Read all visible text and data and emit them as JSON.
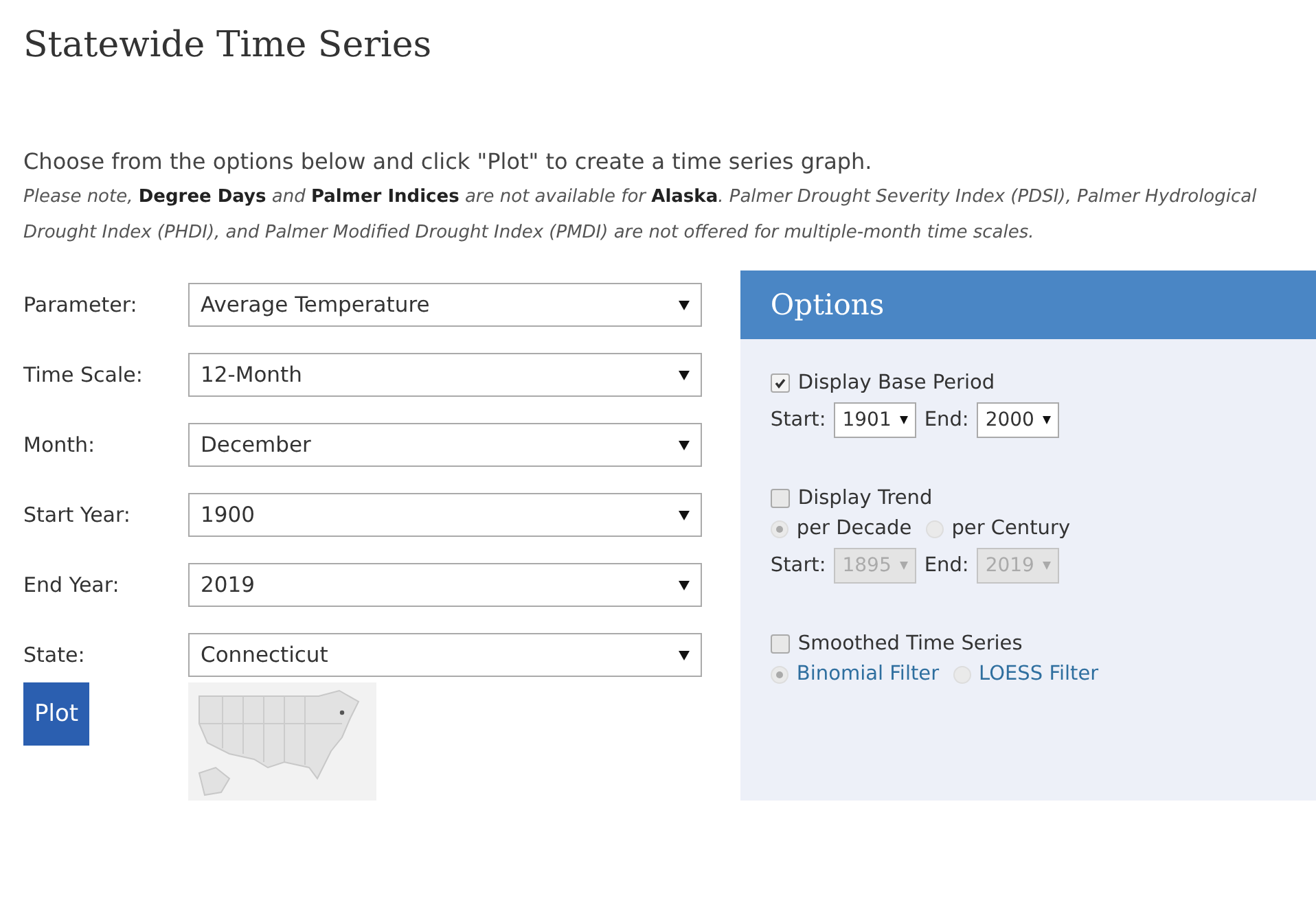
{
  "title": "Statewide Time Series",
  "intro": "Choose from the options below and click \"Plot\" to create a time series graph.",
  "note": "Please note, **Degree Days** and **Palmer Indices** are not available for **Alaska**. Palmer Drought Severity Index (PDSI), Palmer Hydrological Drought Index (PHDI), and Palmer Modified Drought Index (PMDI) are not offered for multiple-month time scales.",
  "fields": [
    {
      "label": "Parameter:",
      "value": "Average Temperature"
    },
    {
      "label": "Time Scale:",
      "value": "12-Month"
    },
    {
      "label": "Month:",
      "value": "December"
    },
    {
      "label": "Start Year:",
      "value": "1900"
    },
    {
      "label": "End Year:",
      "value": "2019"
    },
    {
      "label": "State:",
      "value": "Connecticut"
    }
  ],
  "plot_button": "Plot",
  "options": {
    "title": "Options",
    "groups": [
      {
        "label": "Display Base Period",
        "checked": true,
        "selects": [
          {
            "label": "Start:",
            "value": "1901",
            "disabled": false
          },
          {
            "label": "End:",
            "value": "2000",
            "disabled": false
          }
        ]
      },
      {
        "label": "Display Trend",
        "checked": false,
        "radios": [
          {
            "label": "per Decade",
            "selected": true,
            "link": false
          },
          {
            "label": "per Century",
            "selected": false,
            "link": false
          }
        ],
        "selects": [
          {
            "label": "Start:",
            "value": "1895",
            "disabled": true
          },
          {
            "label": "End:",
            "value": "2019",
            "disabled": true
          }
        ]
      },
      {
        "label": "Smoothed Time Series",
        "checked": false,
        "radios": [
          {
            "label": "Binomial Filter",
            "selected": true,
            "link": true
          },
          {
            "label": "LOESS Filter",
            "selected": false,
            "link": true
          }
        ]
      }
    ]
  }
}
